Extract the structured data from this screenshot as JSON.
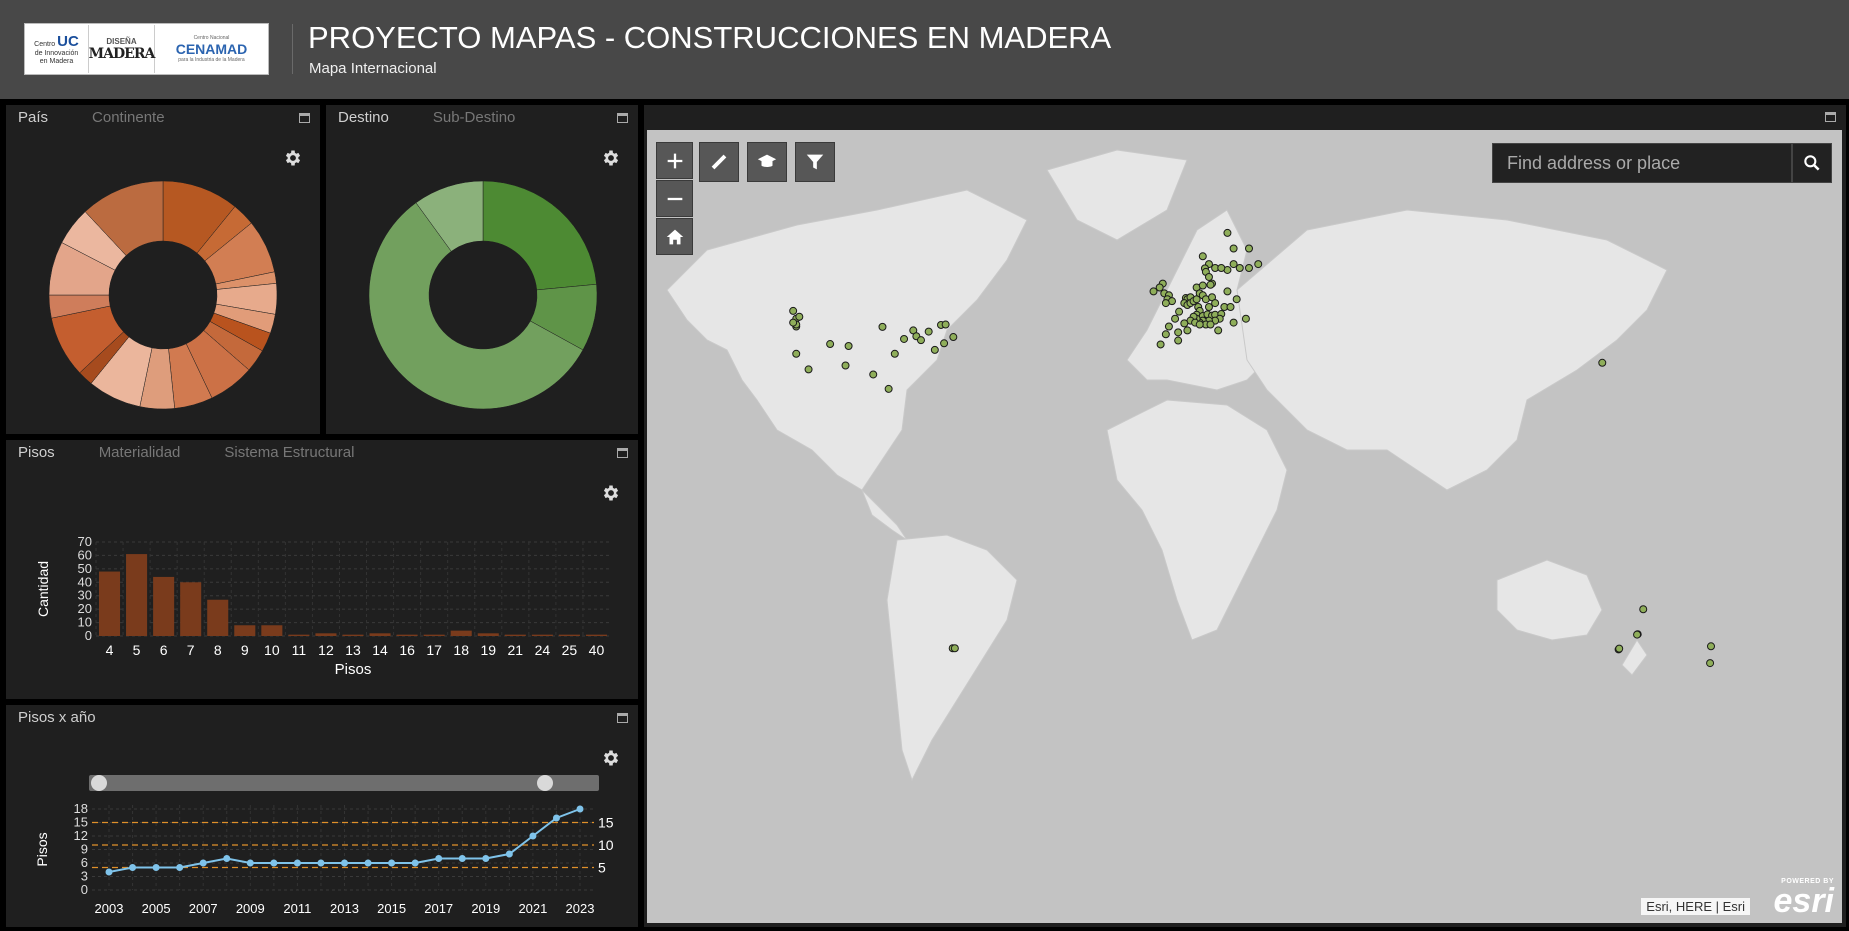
{
  "header": {
    "title": "PROYECTO MAPAS - CONSTRUCCIONES EN MADERA",
    "subtitle": "Mapa Internacional",
    "logos": {
      "uc_line1": "Centro",
      "uc_brand": "UC",
      "uc_line2": "de Innovación",
      "uc_line3": "en Madera",
      "dm_line1": "DISEÑA",
      "dm_line2": "MADERA",
      "cen_small": "Centro Nacional",
      "cen_brand": "CENAMAD",
      "cen_tagline": "para la Industria de la Madera"
    }
  },
  "panel_pais": {
    "tabs": [
      "País",
      "Continente"
    ],
    "active_tab": 0,
    "chart_data": {
      "type": "pie",
      "donut": true,
      "slices": [
        {
          "value": 10.0,
          "color": "#b65822"
        },
        {
          "value": 3.0,
          "color": "#c66a35"
        },
        {
          "value": 7.0,
          "color": "#d27e53"
        },
        {
          "value": 1.5,
          "color": "#dc9169"
        },
        {
          "value": 4.0,
          "color": "#e7aa8c"
        },
        {
          "value": 2.5,
          "color": "#e19c79"
        },
        {
          "value": 2.5,
          "color": "#b9531e"
        },
        {
          "value": 3.0,
          "color": "#c4693b"
        },
        {
          "value": 6.0,
          "color": "#cc7146"
        },
        {
          "value": 5.0,
          "color": "#d17a50"
        },
        {
          "value": 4.5,
          "color": "#de9d7c"
        },
        {
          "value": 7.0,
          "color": "#ebb69c"
        },
        {
          "value": 2.0,
          "color": "#a64b1e"
        },
        {
          "value": 8.0,
          "color": "#c45e2f"
        },
        {
          "value": 3.0,
          "color": "#cf7d5b"
        },
        {
          "value": 7.0,
          "color": "#e3a58a"
        },
        {
          "value": 5.0,
          "color": "#ebb79f"
        },
        {
          "value": 11.0,
          "color": "#bb6b40"
        }
      ]
    }
  },
  "panel_destino": {
    "tabs": [
      "Destino",
      "Sub-Destino"
    ],
    "active_tab": 0,
    "chart_data": {
      "type": "pie",
      "donut": true,
      "slices": [
        {
          "value": 23.5,
          "color": "#4d8a33"
        },
        {
          "value": 9.5,
          "color": "#5f9448"
        },
        {
          "value": 57.0,
          "color": "#72a05e"
        },
        {
          "value": 10.0,
          "color": "#8bb17b"
        }
      ]
    }
  },
  "panel_pisos": {
    "tabs": [
      "Pisos",
      "Materialidad",
      "Sistema Estructural"
    ],
    "active_tab": 0,
    "chart_data": {
      "type": "bar",
      "categories": [
        "4",
        "5",
        "6",
        "7",
        "8",
        "9",
        "10",
        "11",
        "12",
        "13",
        "14",
        "16",
        "17",
        "18",
        "19",
        "21",
        "24",
        "25",
        "40"
      ],
      "values": [
        48,
        61,
        44,
        40,
        27,
        8,
        8,
        1,
        2,
        1,
        2,
        1,
        1,
        4,
        2,
        1,
        1,
        1,
        1
      ],
      "xlabel": "Pisos",
      "ylabel": "Cantidad",
      "ylim": [
        0,
        70
      ],
      "yticks": [
        0,
        10,
        20,
        30,
        40,
        50,
        60,
        70
      ],
      "bar_color": "#7a3b1c",
      "grid": true
    }
  },
  "panel_pisos_anio": {
    "tabs": [
      "Pisos x año"
    ],
    "active_tab": 0,
    "chart_data": {
      "type": "line",
      "x": [
        2003,
        2004,
        2005,
        2006,
        2007,
        2008,
        2009,
        2010,
        2011,
        2012,
        2013,
        2014,
        2015,
        2016,
        2017,
        2018,
        2019,
        2020,
        2021,
        2022,
        2023
      ],
      "y": [
        4,
        5,
        5,
        5,
        6,
        7,
        6,
        6,
        6,
        6,
        6,
        6,
        6,
        6,
        7,
        7,
        7,
        8,
        12,
        16,
        18
      ],
      "ylabel": "Pisos",
      "ylim": [
        0,
        18
      ],
      "yticks": [
        0,
        3,
        6,
        9,
        12,
        15,
        18
      ],
      "xticks": [
        2003,
        2005,
        2007,
        2009,
        2011,
        2013,
        2015,
        2017,
        2019,
        2021,
        2023
      ],
      "reference_lines": [
        5,
        10,
        15
      ],
      "line_color": "#7fc3ea",
      "ref_line_color": "#e0902a",
      "grid": true
    }
  },
  "map": {
    "search_placeholder": "Find address or place",
    "attribution": "Esri, HERE | Esri",
    "powered_by": "POWERED BY",
    "esri": "esri",
    "tools": [
      "zoom-in",
      "zoom-out",
      "home",
      "measure",
      "education",
      "filter"
    ],
    "point_color": "#8fae5a",
    "land_color": "#e6e6e6",
    "water_color": "#c3c3c3",
    "points": [
      [
        -123,
        49
      ],
      [
        -122,
        47
      ],
      [
        -122,
        45
      ],
      [
        -122,
        45.5
      ],
      [
        -123,
        46
      ],
      [
        -121,
        47.5
      ],
      [
        -118,
        34
      ],
      [
        -122,
        38
      ],
      [
        -111,
        40.5
      ],
      [
        -97,
        32.7
      ],
      [
        -94,
        44.9
      ],
      [
        -90,
        38
      ],
      [
        -92,
        29
      ],
      [
        -87,
        41.8
      ],
      [
        -84,
        44
      ],
      [
        -83,
        42.5
      ],
      [
        -79,
        43.7
      ],
      [
        -77,
        39
      ],
      [
        -75,
        45.4
      ],
      [
        -73.5,
        45.5
      ],
      [
        -71,
        42.3
      ],
      [
        -74,
        40.7
      ],
      [
        -81.5,
        41.5
      ],
      [
        -106,
        35
      ],
      [
        -105,
        40
      ],
      [
        -71.2,
        -37.5
      ],
      [
        -70.5,
        -37.5
      ],
      [
        18,
        69
      ],
      [
        20,
        65
      ],
      [
        25,
        65
      ],
      [
        10,
        63
      ],
      [
        12,
        61
      ],
      [
        14,
        60
      ],
      [
        18,
        59.5
      ],
      [
        22,
        60
      ],
      [
        25,
        60
      ],
      [
        28,
        61
      ],
      [
        10.7,
        59.9
      ],
      [
        11,
        59
      ],
      [
        12,
        57.7
      ],
      [
        16,
        60
      ],
      [
        20,
        61
      ],
      [
        13,
        56
      ],
      [
        8,
        55
      ],
      [
        10,
        55.5
      ],
      [
        12.5,
        55.7
      ],
      [
        -3,
        56
      ],
      [
        -4,
        55
      ],
      [
        -6,
        54
      ],
      [
        -2.5,
        53.5
      ],
      [
        -1,
        53
      ],
      [
        -1.5,
        52
      ],
      [
        0,
        51.5
      ],
      [
        -2,
        51
      ],
      [
        4.5,
        52.3
      ],
      [
        5,
        52
      ],
      [
        6,
        52.5
      ],
      [
        4,
        51
      ],
      [
        5,
        50.5
      ],
      [
        6,
        51
      ],
      [
        7,
        51.5
      ],
      [
        8,
        52
      ],
      [
        9,
        53.5
      ],
      [
        10,
        53
      ],
      [
        11,
        52
      ],
      [
        13,
        52.5
      ],
      [
        14,
        51
      ],
      [
        12,
        50
      ],
      [
        8.5,
        50
      ],
      [
        9,
        49
      ],
      [
        8,
        48
      ],
      [
        10,
        47.7
      ],
      [
        11.5,
        48.1
      ],
      [
        13,
        47.8
      ],
      [
        14,
        48
      ],
      [
        16,
        48.2
      ],
      [
        15.5,
        47
      ],
      [
        14,
        46.5
      ],
      [
        12,
        46.5
      ],
      [
        10,
        46.5
      ],
      [
        9,
        46
      ],
      [
        8,
        47
      ],
      [
        7,
        47.5
      ],
      [
        6,
        46.5
      ],
      [
        7.5,
        46
      ],
      [
        11,
        45.5
      ],
      [
        12.5,
        45.5
      ],
      [
        9,
        45.5
      ],
      [
        2.3,
        48.8
      ],
      [
        4,
        45.8
      ],
      [
        1,
        47
      ],
      [
        -1,
        45
      ],
      [
        5,
        44
      ],
      [
        2,
        43.5
      ],
      [
        -2,
        43
      ],
      [
        -3.7,
        40.4
      ],
      [
        2,
        41.4
      ],
      [
        15,
        44
      ],
      [
        17,
        50
      ],
      [
        19,
        50
      ],
      [
        21,
        52
      ],
      [
        18,
        54
      ],
      [
        20,
        46
      ],
      [
        24,
        47
      ],
      [
        139.7,
        35.7
      ],
      [
        153,
        -27.5
      ],
      [
        151.2,
        -33.9
      ],
      [
        151,
        -34
      ],
      [
        145,
        -37.8
      ],
      [
        145.2,
        -37.6
      ],
      [
        175,
        -37
      ],
      [
        174.7,
        -41.3
      ]
    ]
  }
}
